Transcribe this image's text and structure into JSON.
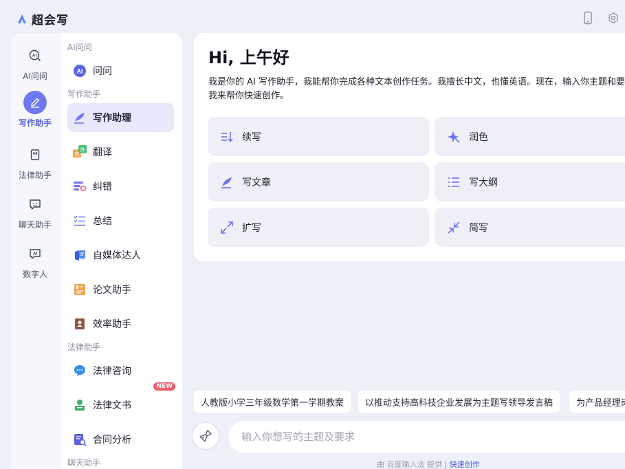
{
  "app": {
    "name": "超会写"
  },
  "rail": [
    {
      "label": "AI问问",
      "icon": "ai-ask-icon",
      "active": false
    },
    {
      "label": "写作助手",
      "icon": "pen-icon",
      "active": true
    },
    {
      "label": "法律助手",
      "icon": "law-book-icon",
      "active": false
    },
    {
      "label": "聊天助手",
      "icon": "chat-icon",
      "active": false
    },
    {
      "label": "数字人",
      "icon": "digital-human-icon",
      "active": false
    }
  ],
  "subnav": {
    "sections": [
      {
        "title": "AI问问"
      },
      {
        "title": "写作助手"
      },
      {
        "title": "法律助手"
      },
      {
        "title": "聊天助手"
      }
    ],
    "items": [
      {
        "label": "问问",
        "icon": "ai-badge-icon"
      },
      {
        "label": "写作助理",
        "icon": "quill-icon",
        "active": true
      },
      {
        "label": "翻译",
        "icon": "translate-icon"
      },
      {
        "label": "纠错",
        "icon": "proofread-icon"
      },
      {
        "label": "总结",
        "icon": "checklist-icon"
      },
      {
        "label": "自媒体达人",
        "icon": "media-icon"
      },
      {
        "label": "论文助手",
        "icon": "paper-icon"
      },
      {
        "label": "效率助手",
        "icon": "efficiency-icon"
      },
      {
        "label": "法律咨询",
        "icon": "consult-icon"
      },
      {
        "label": "法律文书",
        "icon": "legal-doc-icon",
        "badge": "NEW"
      },
      {
        "label": "合同分析",
        "icon": "contract-icon"
      }
    ]
  },
  "main": {
    "greeting": "Hi, 上午好",
    "intro": "我是你的 AI 写作助手，我能帮你完成各种文本创作任务。我擅长中文，也懂英语。现在，输入你主题和要求，我来帮你快速创作。",
    "tools": [
      {
        "label": "续写",
        "icon": "continue-icon"
      },
      {
        "label": "润色",
        "icon": "sparkle-icon"
      },
      {
        "label": "写文章",
        "icon": "quill-icon"
      },
      {
        "label": "写大纲",
        "icon": "outline-icon"
      },
      {
        "label": "扩写",
        "icon": "expand-icon"
      },
      {
        "label": "简写",
        "icon": "shrink-icon"
      }
    ]
  },
  "suggestions": [
    "人教版小学三年级数学第一学期教案",
    "以推动支持高科技企业发展为主题写领导发言稿",
    "为产品经理岗"
  ],
  "input": {
    "placeholder": "输入你想写的主题及要求"
  },
  "footer": {
    "prefix": "由 百度输入法 提供",
    "separator": "|",
    "link": "快速创作"
  },
  "colors": {
    "accent": "#6e78f0",
    "active_bg": "#e8e8fb",
    "badge": "#f05a6a"
  }
}
